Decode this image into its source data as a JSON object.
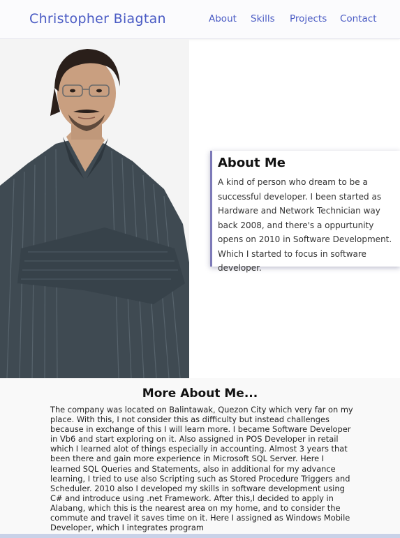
{
  "navbar": {
    "brand": "Christopher Biagtan",
    "links": [
      "About",
      "Skills",
      "Projects",
      "Contact"
    ]
  },
  "hero": {
    "photo_icon": "portrait-photo"
  },
  "about": {
    "title": "About Me",
    "text": "A kind of person who dream to be a successful developer. I been started as Hardware and Network Technician way back 2008, and there's a oppurtunity opens on 2010 in Software Development. Which I started to focus in software developer."
  },
  "more": {
    "title": "More About Me...",
    "text": "The company was located on Balintawak, Quezon City which very far on my place. With this, I not consider this as difficulty but instead challenges because in exchange of this I will learn more. I became Software Developer in Vb6 and start exploring on it. Also assigned in POS Developer in retail which I learned alot of things especially in accounting. Almost 3 years that been there and gain more experience in Microsoft SQL Server. Here I learned SQL Queries and Statements, also in additional for my advance learning, I tried to use also Scripting such as Stored Procedure Triggers and Scheduler. 2010 also I developed my skills in software development using C# and introduce using .net Framework. After this,I decided to apply in Alabang, which this is the nearest area on my home, and to consider the commute and travel it saves time on it. Here I assigned as Windows Mobile Developer, which I integrates program"
  },
  "colors": {
    "accent": "#4a5bc4",
    "card_border": "#7d7ab8"
  }
}
